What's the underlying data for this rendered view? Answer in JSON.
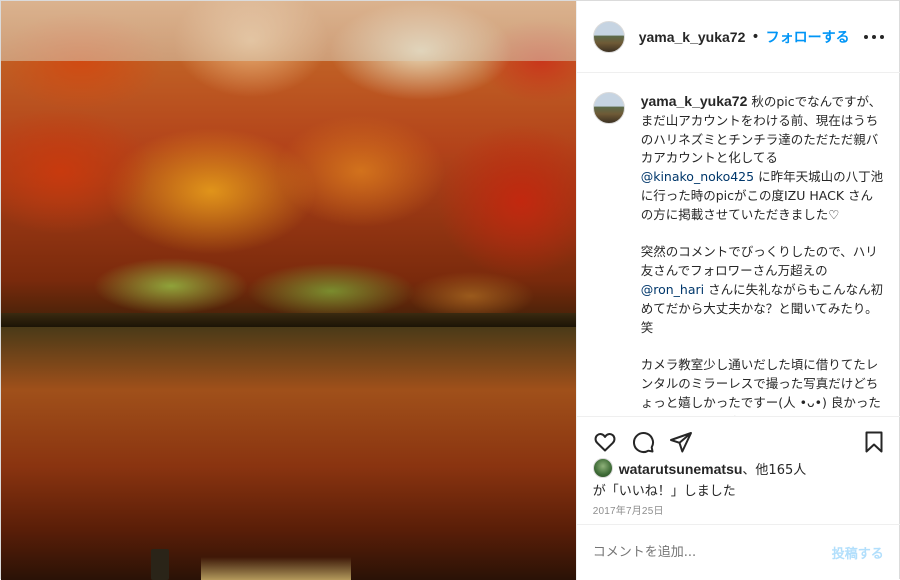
{
  "header": {
    "username": "yama_k_yuka72",
    "separator": "•",
    "follow_label": "フォローする",
    "more_icon": "more-horizontal-icon"
  },
  "caption": {
    "username": "yama_k_yuka72",
    "p1_a": "秋のpicでなんですが、まだ山アカウントをわける前、現在はうちのハリネズミとチンチラ達のただただ親バカアカウントと化してる",
    "p1_mention": "@kinako_noko425",
    "p1_b": "に昨年天城山の八丁池に行った時のpicがこの度IZU HACK さんの方に掲載させていただきました♡",
    "p2_a": "突然のコメントでびっくりしたので、ハリ友さんでフォロワーさん万超えの",
    "p2_mention": "@ron_hari",
    "p2_b": "さんに失礼ながらもこんなん初めてだから大丈夫かな？と聞いてみたり。笑",
    "p3": "カメラ教室少し通いだした頃に借りてたレンタルのミラーレスで撮った写真だけどちょっと嬉しかったですー(人 •ᴗ•) 良かったらみてみてください♪"
  },
  "actions": {
    "like_icon": "heart-icon",
    "comment_icon": "comment-icon",
    "share_icon": "paper-plane-icon",
    "save_icon": "bookmark-icon"
  },
  "likes": {
    "user": "watarutsunematsu",
    "rest": "、他165人",
    "line2": "が「いいね！」しました"
  },
  "date": "2017年7月25日",
  "comment": {
    "placeholder": "コメントを追加...",
    "post_label": "投稿する"
  },
  "colors": {
    "accent": "#0095f6",
    "mention": "#00376b",
    "post_disabled": "#b2dffc",
    "muted": "#8e8e8e"
  }
}
